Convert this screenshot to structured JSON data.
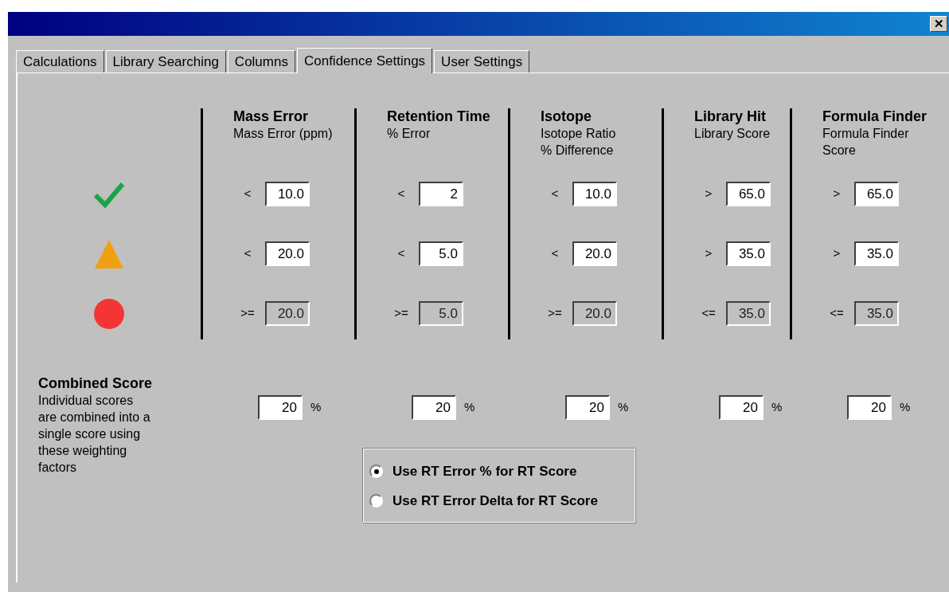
{
  "window": {
    "close_label": "✕"
  },
  "tabs": [
    {
      "label": "Calculations",
      "selected": false
    },
    {
      "label": "Library Searching",
      "selected": false
    },
    {
      "label": "Columns",
      "selected": false
    },
    {
      "label": "Confidence Settings",
      "selected": true
    },
    {
      "label": "User Settings",
      "selected": false
    }
  ],
  "levels": [
    {
      "kind": "check",
      "color": "#1aa34a"
    },
    {
      "kind": "triangle",
      "color": "#f0a010"
    },
    {
      "kind": "circle",
      "color": "#f53535"
    }
  ],
  "criteria": [
    {
      "title": "Mass Error",
      "subtitle": "Mass Error (ppm)",
      "thresholds": [
        {
          "operator": "<",
          "value": "10.0",
          "disabled": false
        },
        {
          "operator": "<",
          "value": "20.0",
          "disabled": false
        },
        {
          "operator": ">=",
          "value": "20.0",
          "disabled": true
        }
      ]
    },
    {
      "title": "Retention Time",
      "subtitle": "% Error",
      "thresholds": [
        {
          "operator": "<",
          "value": "2",
          "disabled": false
        },
        {
          "operator": "<",
          "value": "5.0",
          "disabled": false
        },
        {
          "operator": ">=",
          "value": "5.0",
          "disabled": true
        }
      ]
    },
    {
      "title": "Isotope",
      "subtitle": "Isotope Ratio\n% Difference",
      "thresholds": [
        {
          "operator": "<",
          "value": "10.0",
          "disabled": false
        },
        {
          "operator": "<",
          "value": "20.0",
          "disabled": false
        },
        {
          "operator": ">=",
          "value": "20.0",
          "disabled": true
        }
      ]
    },
    {
      "title": "Library Hit",
      "subtitle": "Library Score",
      "thresholds": [
        {
          "operator": ">",
          "value": "65.0",
          "disabled": false
        },
        {
          "operator": ">",
          "value": "35.0",
          "disabled": false
        },
        {
          "operator": "<=",
          "value": "35.0",
          "disabled": true
        }
      ]
    },
    {
      "title": "Formula Finder",
      "subtitle": "Formula Finder\nScore",
      "thresholds": [
        {
          "operator": ">",
          "value": "65.0",
          "disabled": false
        },
        {
          "operator": ">",
          "value": "35.0",
          "disabled": false
        },
        {
          "operator": "<=",
          "value": "35.0",
          "disabled": true
        }
      ]
    }
  ],
  "combined": {
    "title": "Combined Score",
    "description": "Individual scores\nare combined into a\nsingle score using\nthese weighting\nfactors",
    "weights": [
      {
        "value": "20",
        "unit": "%"
      },
      {
        "value": "20",
        "unit": "%"
      },
      {
        "value": "20",
        "unit": "%"
      },
      {
        "value": "20",
        "unit": "%"
      },
      {
        "value": "20",
        "unit": "%"
      }
    ]
  },
  "rt_options": [
    {
      "label": "Use RT Error % for RT Score",
      "selected": true
    },
    {
      "label": "Use RT Error Delta  for RT Score",
      "selected": false
    }
  ]
}
